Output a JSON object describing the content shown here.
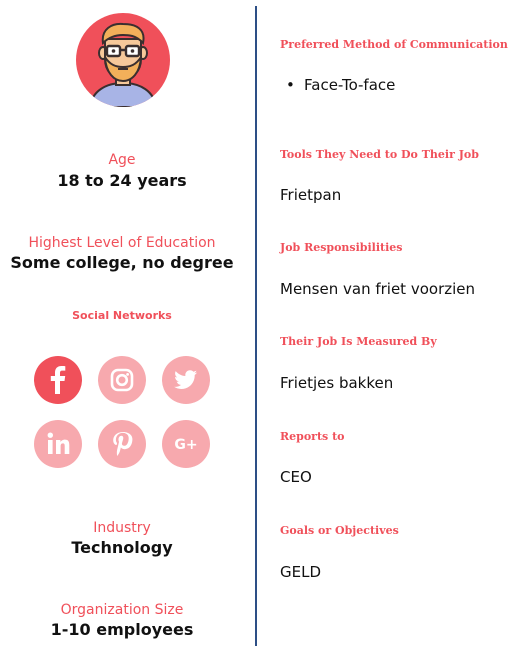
{
  "persona": {
    "age": {
      "label": "Age",
      "value": "18 to 24 years"
    },
    "education": {
      "label": "Highest Level of Education",
      "value": "Some college, no degree"
    },
    "social": {
      "label": "Social Networks",
      "networks": [
        {
          "name": "facebook",
          "icon": "facebook-icon",
          "active": true
        },
        {
          "name": "instagram",
          "icon": "instagram-icon",
          "active": false
        },
        {
          "name": "twitter",
          "icon": "twitter-icon",
          "active": false
        },
        {
          "name": "linkedin",
          "icon": "linkedin-icon",
          "active": false
        },
        {
          "name": "pinterest",
          "icon": "pinterest-icon",
          "active": false
        },
        {
          "name": "google-plus",
          "icon": "google-plus-icon",
          "active": false
        }
      ]
    },
    "industry": {
      "label": "Industry",
      "value": "Technology"
    },
    "org_size": {
      "label": "Organization Size",
      "value": "1-10 employees"
    }
  },
  "details": {
    "communication": {
      "label": "Preferred Method of Communication",
      "items": [
        "Face-To-face"
      ]
    },
    "tools": {
      "label": "Tools They Need to Do Their Job",
      "value": "Frietpan"
    },
    "responsibilities": {
      "label": "Job Responsibilities",
      "value": "Mensen van friet voorzien"
    },
    "measured_by": {
      "label": "Their Job Is Measured By",
      "value": "Frietjes bakken"
    },
    "reports_to": {
      "label": "Reports to",
      "value": "CEO"
    },
    "goals": {
      "label": "Goals or Objectives",
      "value": "GELD"
    }
  },
  "colors": {
    "accent": "#f0505a",
    "accent_light": "#f7a9ae",
    "divider": "#2d4f86"
  }
}
